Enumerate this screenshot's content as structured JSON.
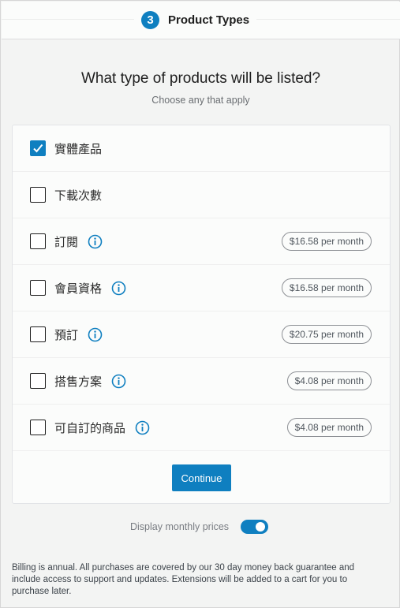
{
  "header": {
    "step_number": "3",
    "step_title": "Product Types"
  },
  "main": {
    "title": "What type of products will be listed?",
    "subtitle": "Choose any that apply",
    "options": [
      {
        "label": "實體產品",
        "checked": true,
        "info": false,
        "price": null
      },
      {
        "label": "下載次數",
        "checked": false,
        "info": false,
        "price": null
      },
      {
        "label": "訂閱",
        "checked": false,
        "info": true,
        "price": "$16.58 per month"
      },
      {
        "label": "會員資格",
        "checked": false,
        "info": true,
        "price": "$16.58 per month"
      },
      {
        "label": "預訂",
        "checked": false,
        "info": true,
        "price": "$20.75 per month"
      },
      {
        "label": "搭售方案",
        "checked": false,
        "info": true,
        "price": "$4.08 per month"
      },
      {
        "label": "可自訂的商品",
        "checked": false,
        "info": true,
        "price": "$4.08 per month"
      }
    ],
    "continue_label": "Continue"
  },
  "toggle": {
    "label": "Display monthly prices",
    "on": true
  },
  "footer": {
    "text": "Billing is annual. All purchases are covered by our 30 day money back guarantee and include access to support and updates. Extensions will be added to a cart for you to purchase later."
  },
  "colors": {
    "accent": "#0f7fc0",
    "background": "#f3f4f3",
    "card": "#fbfcfb"
  }
}
